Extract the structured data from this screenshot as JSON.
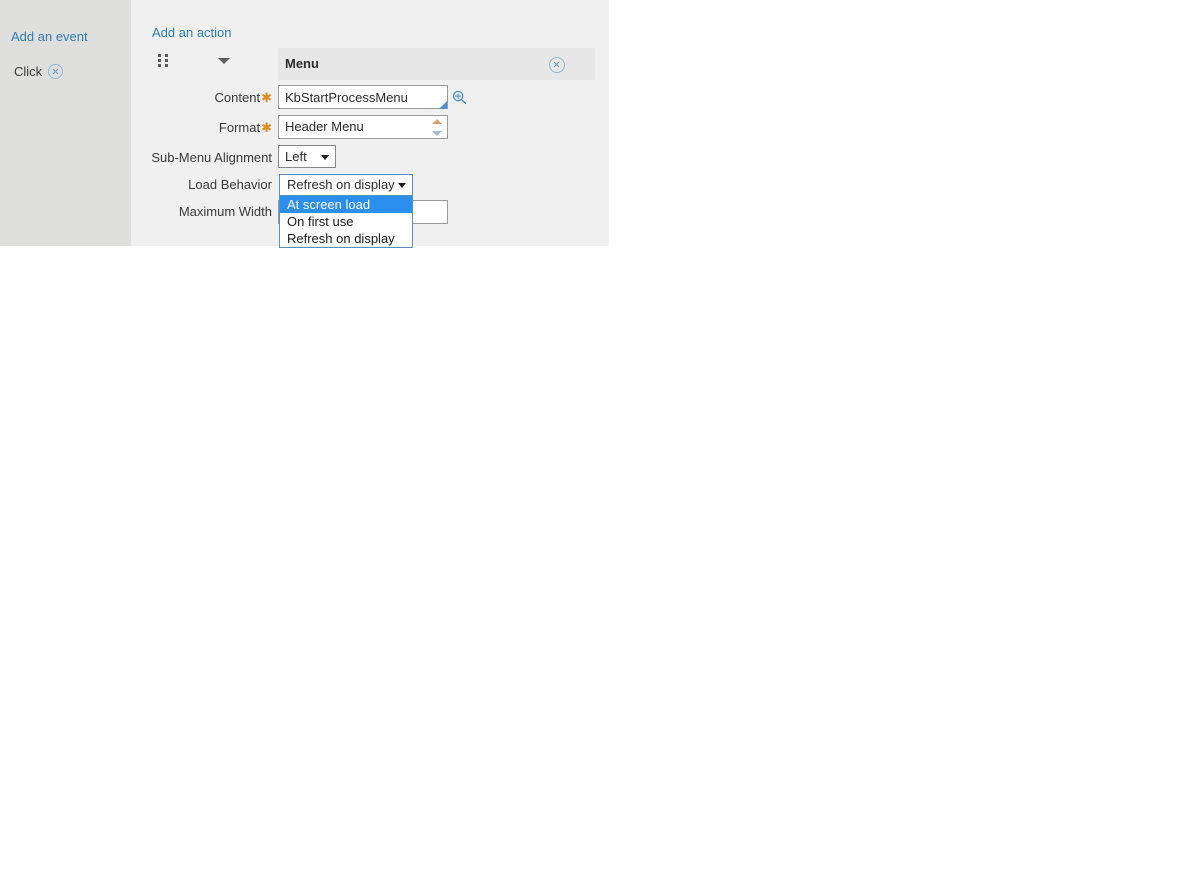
{
  "events_sidebar": {
    "add_event_label": "Add an event",
    "event": {
      "label": "Click",
      "remove_icon": "circle-x-icon"
    }
  },
  "action_panel": {
    "add_action_label": "Add an action",
    "header": {
      "drag_icon": "drag-handle-icon",
      "collapse_icon": "caret-down-icon",
      "title": "Menu",
      "close_icon": "circle-x-icon"
    },
    "properties": [
      {
        "label": "Content",
        "required": true,
        "value": "KbStartProcessMenu",
        "search_icon": "magnifier-icon"
      },
      {
        "label": "Format",
        "required": true,
        "value": "Header Menu"
      },
      {
        "label": "Sub-Menu Alignment",
        "required": false,
        "value": "Left"
      },
      {
        "label": "Load Behavior",
        "required": false,
        "value": "Refresh on display",
        "expanded": true,
        "options": [
          "At screen load",
          "On first use",
          "Refresh on display"
        ],
        "highlighted_option": "At screen load"
      },
      {
        "label": "Maximum Width",
        "required": false,
        "value": ""
      }
    ]
  },
  "colors": {
    "link": "#2e7dbf",
    "required_star": "#e08b1e",
    "dropdown_highlight": "#2a8fef",
    "sidebar_bg": "#dfdfde",
    "panel_bg": "#f0f0f0",
    "header_bg": "#e7e7e7"
  }
}
